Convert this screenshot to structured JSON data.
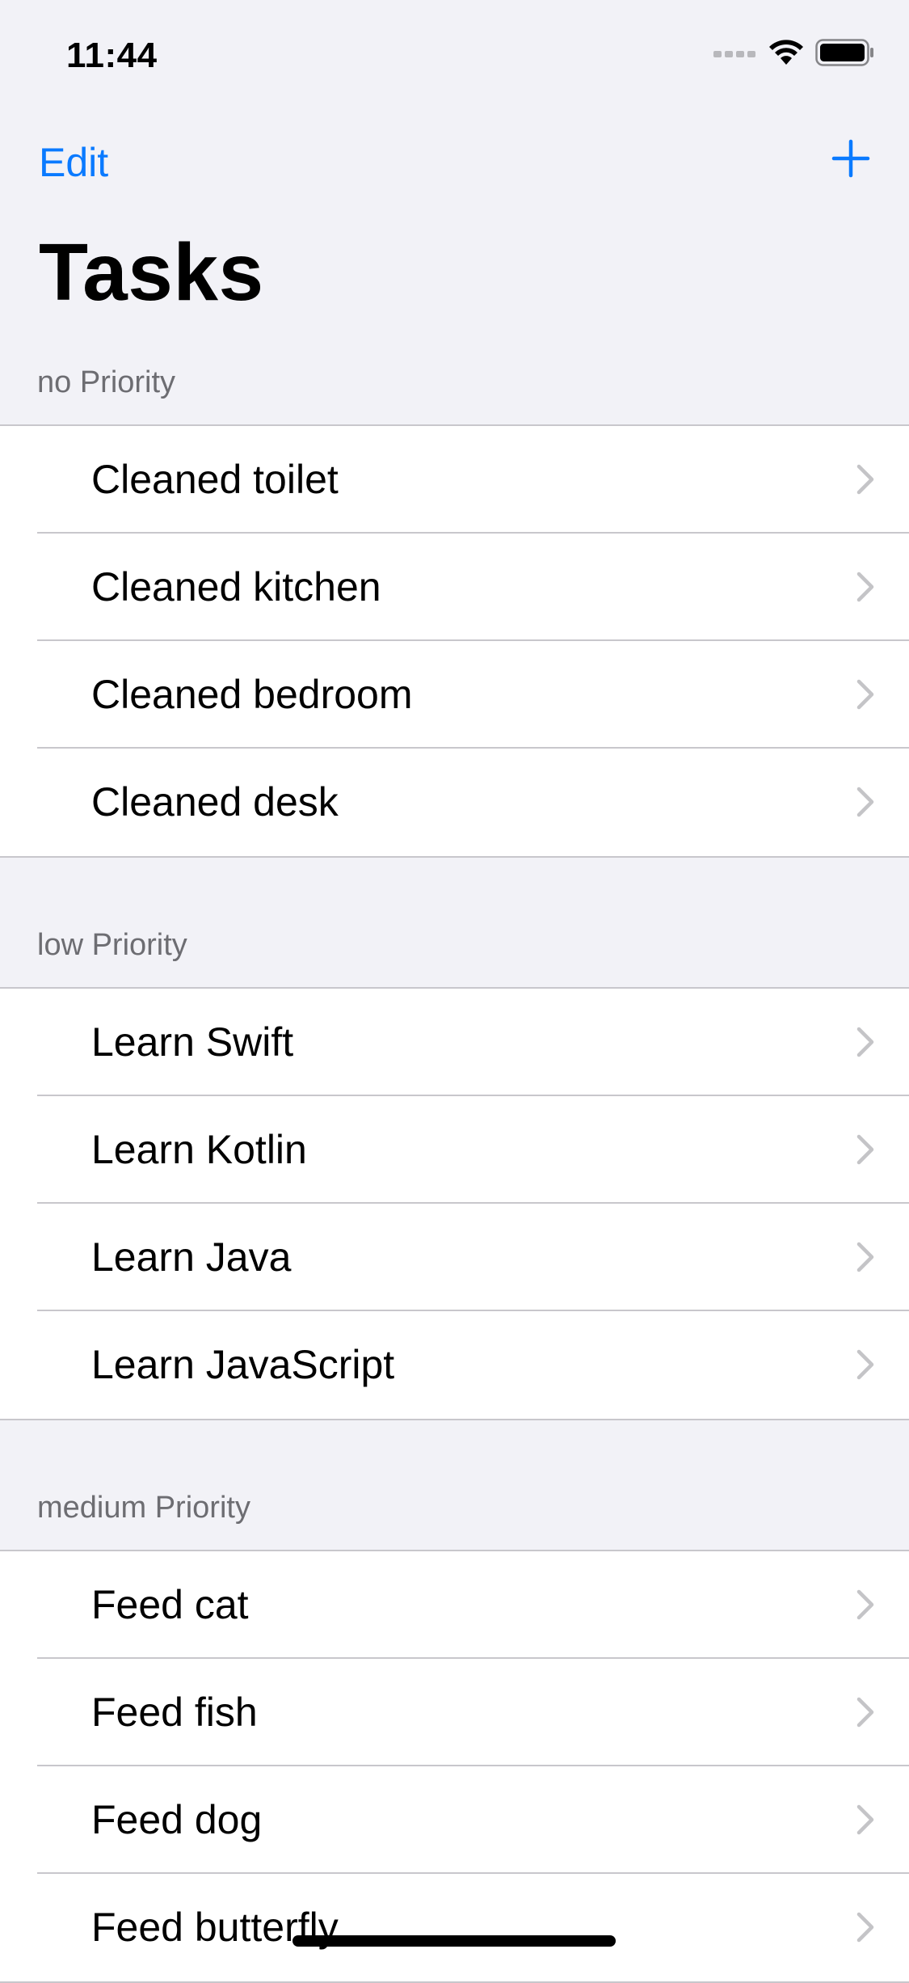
{
  "status_bar": {
    "time": "11:44",
    "icons": [
      "signal-icon",
      "wifi-icon",
      "battery-icon"
    ]
  },
  "nav": {
    "edit_label": "Edit",
    "add_icon": "plus-icon",
    "title": "Tasks"
  },
  "colors": {
    "accent": "#0a7aff",
    "background": "#f2f2f7",
    "section_text": "#6d6d72",
    "separator": "#c8c7cc",
    "chevron": "#c4c4c7"
  },
  "sections": [
    {
      "header": "no Priority",
      "items": [
        "Cleaned toilet",
        "Cleaned kitchen",
        "Cleaned bedroom",
        "Cleaned desk"
      ]
    },
    {
      "header": "low Priority",
      "items": [
        "Learn Swift",
        "Learn Kotlin",
        "Learn Java",
        "Learn JavaScript"
      ]
    },
    {
      "header": "medium Priority",
      "items": [
        "Feed cat",
        "Feed fish",
        "Feed dog",
        "Feed butterfly"
      ]
    }
  ]
}
